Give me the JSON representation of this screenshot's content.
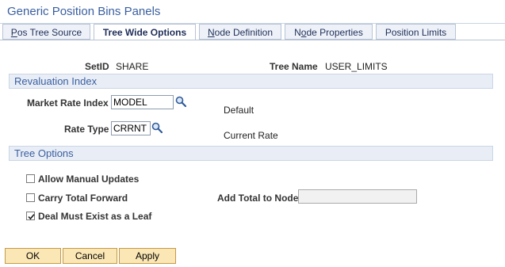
{
  "page": {
    "title": "Generic Position Bins Panels"
  },
  "tabs": [
    {
      "prefix": "",
      "ul": "P",
      "rest": "os Tree Source"
    },
    {
      "prefix": "Tree Wide Options",
      "ul": "",
      "rest": ""
    },
    {
      "prefix": "",
      "ul": "N",
      "rest": "ode Definition"
    },
    {
      "prefix": "N",
      "ul": "o",
      "rest": "de Properties"
    },
    {
      "prefix": "Position Limits",
      "ul": "",
      "rest": ""
    }
  ],
  "header_fields": {
    "setid_label": "SetID",
    "setid_value": "SHARE",
    "tree_name_label": "Tree Name",
    "tree_name_value": "USER_LIMITS"
  },
  "revaluation": {
    "title": "Revaluation Index",
    "market_rate_label": "Market Rate Index",
    "market_rate_value": "MODEL",
    "market_rate_desc": "Default",
    "rate_type_label": "Rate Type",
    "rate_type_value": "CRRNT",
    "rate_type_desc": "Current Rate"
  },
  "tree_options": {
    "title": "Tree Options",
    "allow_manual_label": "Allow Manual Updates",
    "allow_manual_checked": false,
    "carry_total_label": "Carry Total Forward",
    "carry_total_checked": false,
    "add_total_label": "Add Total to Node",
    "add_total_value": "",
    "deal_leaf_label": "Deal Must Exist as a Leaf",
    "deal_leaf_checked": true
  },
  "buttons": {
    "ok": "OK",
    "cancel": "Cancel",
    "apply": "Apply"
  },
  "colors": {
    "accent": "#3a5fa0",
    "button_bg": "#fbe7b5",
    "section_bg": "#e9eef6"
  },
  "icons": {
    "lookup": "search-icon",
    "checkmark": "checkmark-icon"
  }
}
